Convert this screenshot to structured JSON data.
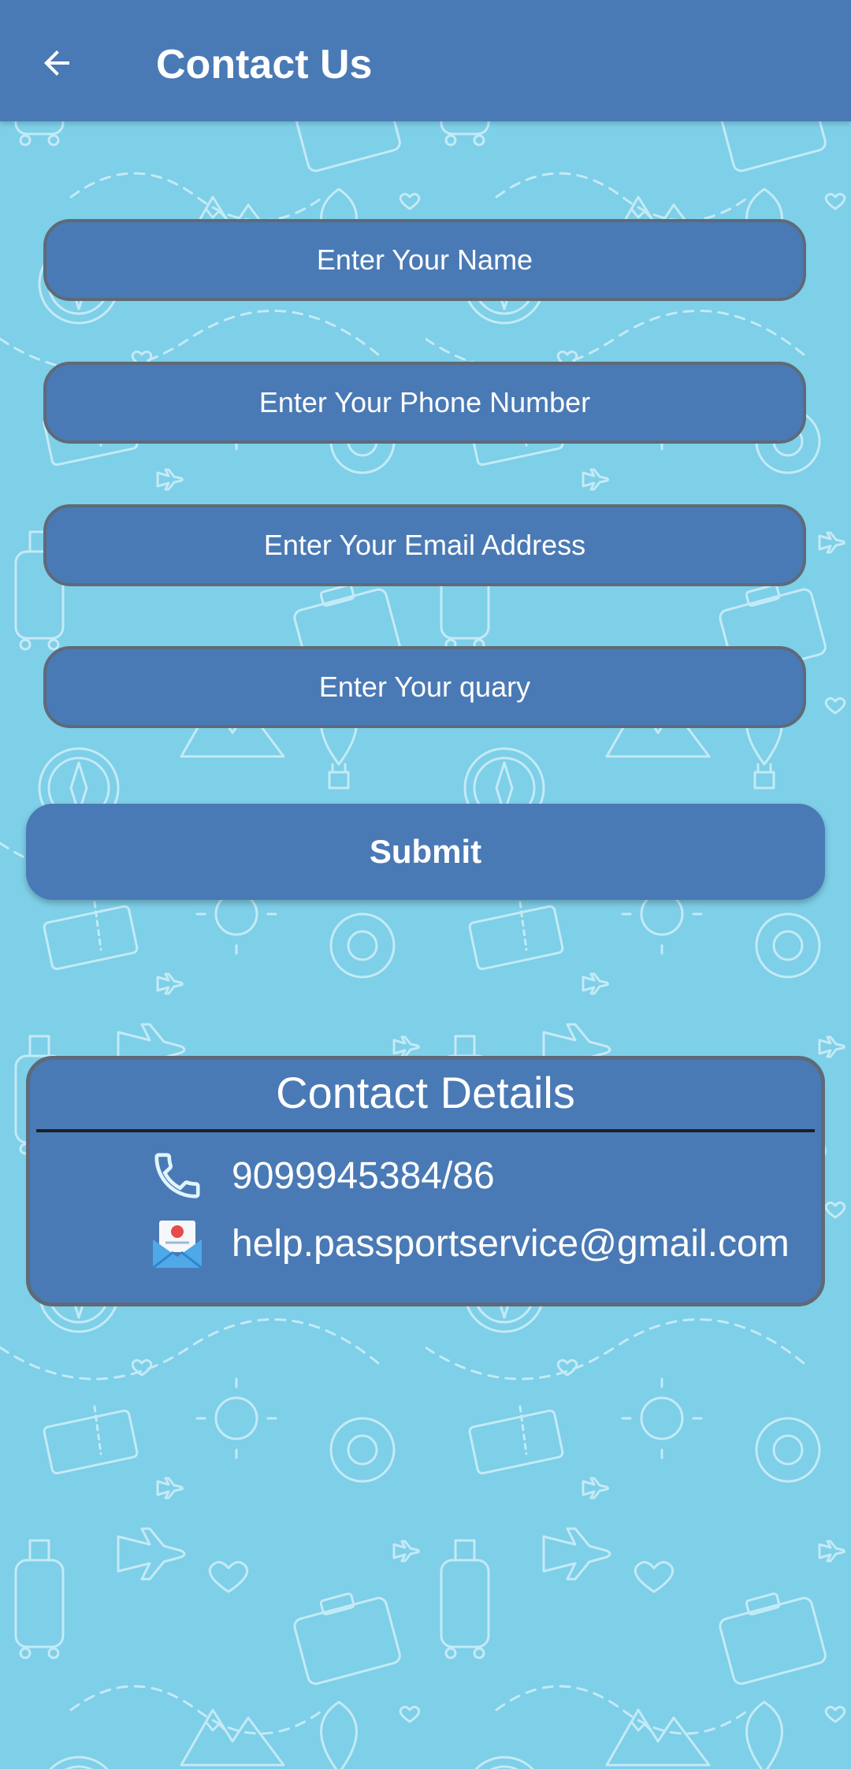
{
  "app_bar": {
    "title": "Contact Us",
    "back_icon": "arrow-back-icon",
    "color": "#4a7ab5"
  },
  "form": {
    "name_placeholder": "Enter Your Name",
    "phone_placeholder": "Enter Your Phone Number",
    "email_placeholder": "Enter Your Email Address",
    "query_placeholder": "Enter Your quary",
    "submit_label": "Submit"
  },
  "contact_details": {
    "title": "Contact Details",
    "phone": "9099945384/86",
    "phone_icon": "phone-icon",
    "email": "help.passportservice@gmail.com",
    "email_icon": "email-icon"
  },
  "colors": {
    "background": "#7ecfe8",
    "accent": "#4a7ab5",
    "field_border": "#5e6a78"
  }
}
